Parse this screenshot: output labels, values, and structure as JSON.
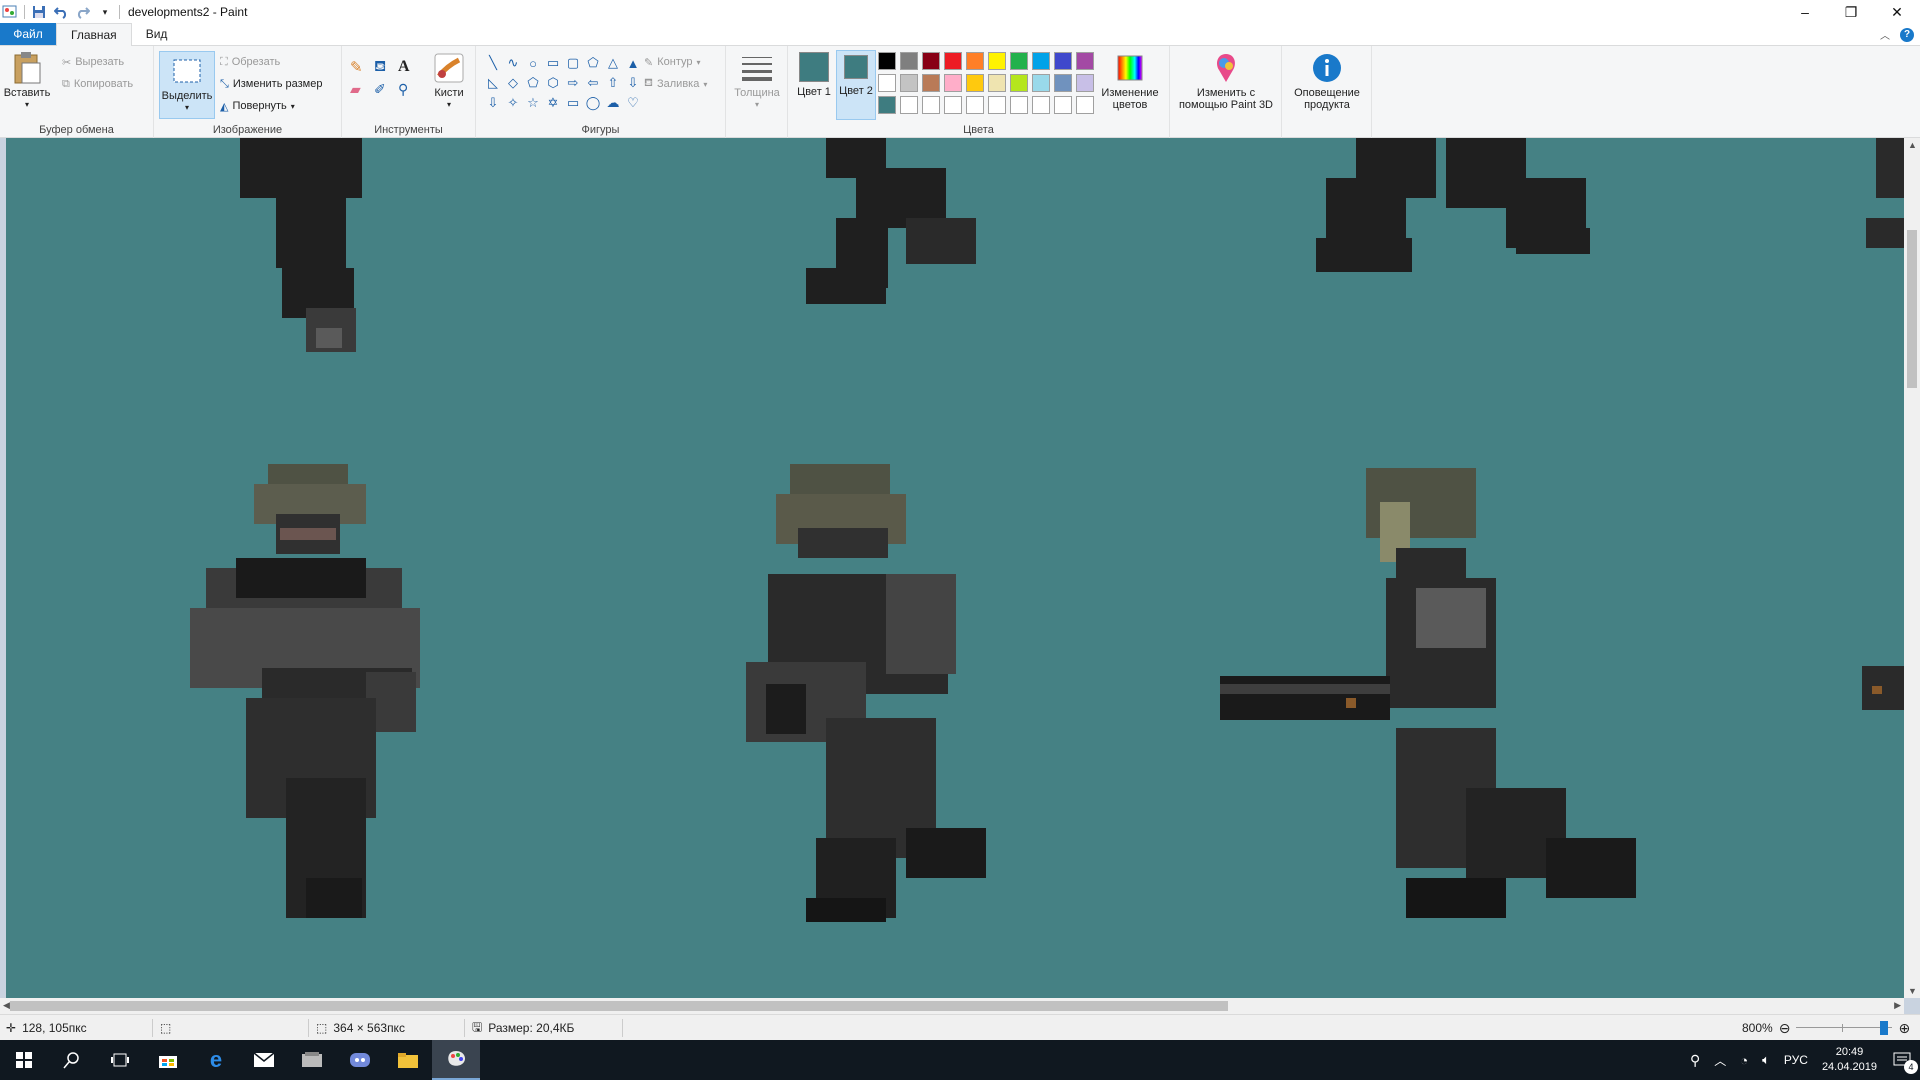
{
  "window": {
    "title": "developments2 - Paint",
    "min": "–",
    "restore": "❐",
    "close": "✕"
  },
  "tabs": {
    "file": "Файл",
    "home": "Главная",
    "view": "Вид"
  },
  "clipboard": {
    "paste": "Вставить",
    "cut": "Вырезать",
    "copy": "Копировать",
    "label": "Буфер обмена"
  },
  "image": {
    "select": "Выделить",
    "crop": "Обрезать",
    "resize": "Изменить размер",
    "rotate": "Повернуть",
    "label": "Изображение"
  },
  "tools": {
    "label": "Инструменты",
    "brushes": "Кисти"
  },
  "shapes": {
    "label": "Фигуры",
    "outline": "Контур",
    "fill": "Заливка",
    "items": [
      "╲",
      "∿",
      "○",
      "▭",
      "▢",
      "⬠",
      "△",
      "▲",
      "◺",
      "◇",
      "⬠",
      "⬡",
      "⇨",
      "⇦",
      "⇧",
      "⇩",
      "⇩",
      "✧",
      "☆",
      "✡",
      "▭",
      "◯",
      "☁",
      "♡"
    ]
  },
  "size": {
    "label": "Толщина"
  },
  "colors": {
    "label": "Цвета",
    "color1": "Цвет 1",
    "color2": "Цвет 2",
    "color1_value": "#3e7c80",
    "color2_value": "#3e7c80",
    "edit": "Изменение цветов",
    "palette": [
      "#000000",
      "#7f7f7f",
      "#880015",
      "#ed1c24",
      "#ff7f27",
      "#fff200",
      "#22b14c",
      "#00a2e8",
      "#3f48cc",
      "#a349a4",
      "#ffffff",
      "#c3c3c3",
      "#b97a57",
      "#ffaec9",
      "#ffc90e",
      "#efe4b0",
      "#b5e61d",
      "#99d9ea",
      "#7092be",
      "#c8bfe7",
      "#3e7c80",
      "#ffffff",
      "#ffffff",
      "#ffffff",
      "#ffffff",
      "#ffffff",
      "#ffffff",
      "#ffffff",
      "#ffffff",
      "#ffffff"
    ]
  },
  "paint3d": {
    "label": "Изменить с помощью Paint 3D"
  },
  "notify": {
    "label": "Оповещение продукта"
  },
  "status": {
    "cursor": "128, 105пкс",
    "selection": "",
    "dimensions": "364 × 563пкс",
    "filesize": "Размер: 20,4КБ",
    "zoom": "800%"
  },
  "taskbar": {
    "lang": "РУС",
    "time": "20:49",
    "date": "24.04.2019",
    "notif_count": "4"
  },
  "canvas": {
    "background": "#458184"
  }
}
